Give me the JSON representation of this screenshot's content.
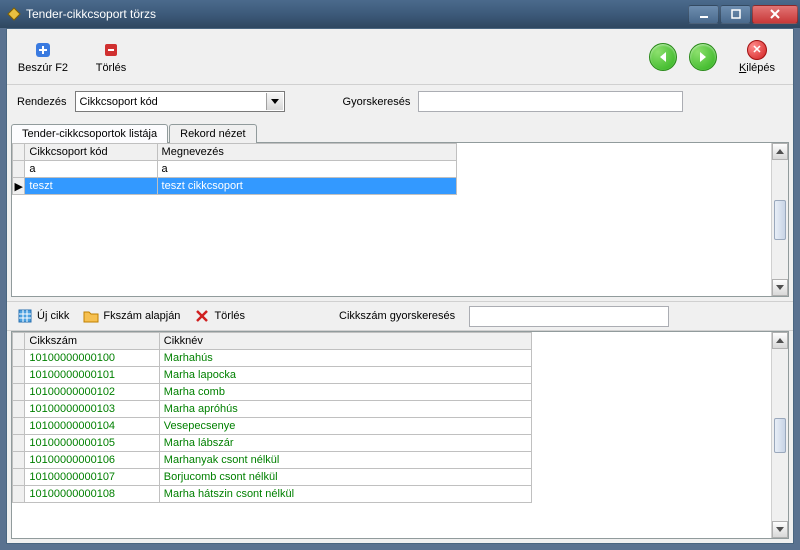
{
  "window_title": "Tender-cikkcsoport törzs",
  "toolbar": {
    "insert_label": "Beszúr F2",
    "delete_label": "Törlés",
    "exit_label": "Kilépés"
  },
  "sortbar": {
    "order_label": "Rendezés",
    "order_value": "Cikkcsoport kód",
    "quicksearch_label": "Gyorskeresés",
    "quicksearch_value": ""
  },
  "tabs": {
    "list": "Tender-cikkcsoportok listája",
    "record": "Rekord nézet"
  },
  "top_grid": {
    "col1": "Cikkcsoport kód",
    "col2": "Megnevezés",
    "rows": [
      {
        "code": "a",
        "name": "a",
        "selected": false
      },
      {
        "code": "teszt",
        "name": "teszt cikkcsoport",
        "selected": true
      }
    ]
  },
  "toolbar2": {
    "new_label": "Új cikk",
    "byfk_label": "Fkszám alapján",
    "delete_label": "Törlés",
    "qs_label": "Cikkszám gyorskeresés",
    "qs_value": ""
  },
  "bottom_grid": {
    "col1": "Cikkszám",
    "col2": "Cikknév",
    "rows": [
      {
        "code": "10100000000100",
        "name": "Marhahús"
      },
      {
        "code": "10100000000101",
        "name": "Marha lapocka"
      },
      {
        "code": "10100000000102",
        "name": "Marha comb"
      },
      {
        "code": "10100000000103",
        "name": "Marha apróhús"
      },
      {
        "code": "10100000000104",
        "name": "Vesepecsenye"
      },
      {
        "code": "10100000000105",
        "name": "Marha lábszár"
      },
      {
        "code": "10100000000106",
        "name": "Marhanyak csont nélkül"
      },
      {
        "code": "10100000000107",
        "name": "Borjucomb csont nélkül"
      },
      {
        "code": "10100000000108",
        "name": "Marha hátszin csont nélkül"
      }
    ]
  }
}
